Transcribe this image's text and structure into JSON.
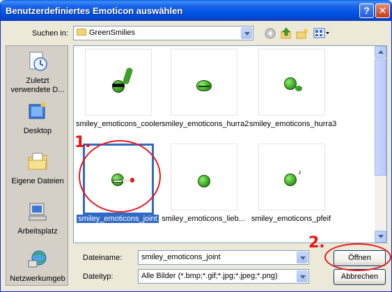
{
  "window": {
    "title": "Benutzerdefiniertes Emoticon auswählen",
    "help_glyph": "?",
    "close_glyph": "✕"
  },
  "lookin": {
    "label": "Suchen in:",
    "value": "GreenSmilies"
  },
  "places": [
    {
      "label": "Zuletzt verwendete D...",
      "icon": "recent-documents-icon"
    },
    {
      "label": "Desktop",
      "icon": "desktop-icon"
    },
    {
      "label": "Eigene Dateien",
      "icon": "my-documents-icon"
    },
    {
      "label": "Arbeitsplatz",
      "icon": "my-computer-icon"
    },
    {
      "label": "Netzwerkumgeb",
      "icon": "network-icon"
    }
  ],
  "files": [
    {
      "name": "smiley_emoticons_cooler",
      "selected": false
    },
    {
      "name": "smiley_emoticons_hurra2",
      "selected": false
    },
    {
      "name": "smiley_emoticons_hurra3",
      "selected": false
    },
    {
      "name": "smiley_emoticons_joint",
      "selected": true
    },
    {
      "name": "smiley_emoticons_lieb...",
      "selected": false
    },
    {
      "name": "smiley_emoticons_pfeif",
      "selected": false
    }
  ],
  "filename": {
    "label": "Dateiname:",
    "value": "smiley_emoticons_joint"
  },
  "filetype": {
    "label": "Dateityp:",
    "value": "Alle Bilder (*.bmp;*.gif;*.jpg;*.jpeg;*.png)"
  },
  "buttons": {
    "open": "Öffnen",
    "cancel": "Abbrechen"
  },
  "annotations": {
    "step1": "1.",
    "step2": "2."
  },
  "colors": {
    "titlebar": "#0055e5",
    "selection": "#316ac5",
    "annotation": "#e81818"
  }
}
